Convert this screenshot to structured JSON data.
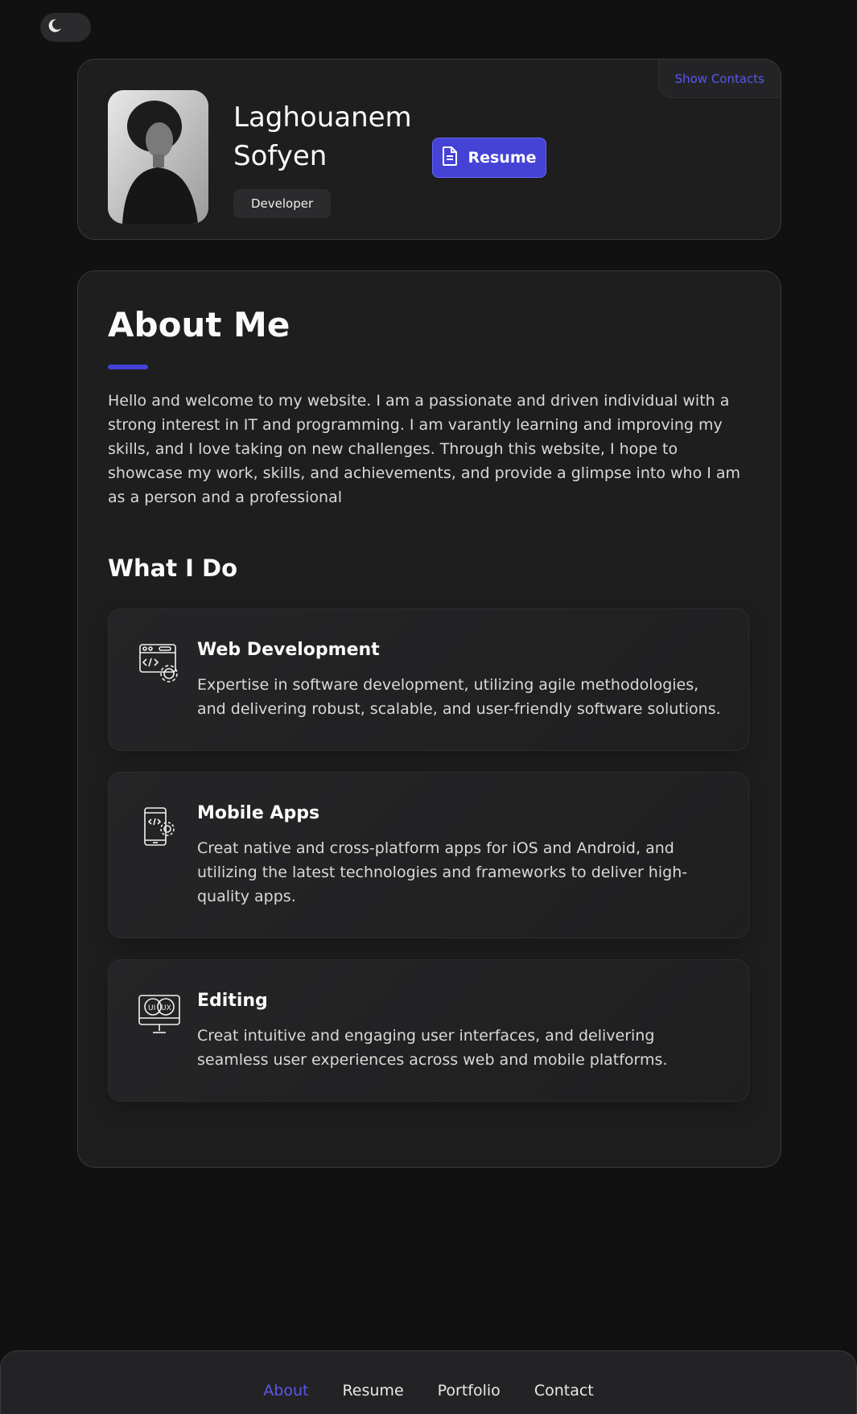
{
  "theme_toggle": {
    "icon": "moon-icon"
  },
  "profile": {
    "name_line1": "Laghouanem",
    "name_line2": "Sofyen",
    "role": "Developer",
    "resume_label": "Resume",
    "show_contacts_label": "Show Contacts"
  },
  "about": {
    "title": "About Me",
    "text": "Hello and welcome to my website. I am a passionate and driven individual with a strong interest in IT and programming. I am varantly learning and improving my skills, and I love taking on new challenges. Through this website, I hope to showcase my work, skills, and achievements, and provide a glimpse into who I am as a person and a professional",
    "what_i_do_title": "What I Do",
    "services": [
      {
        "icon": "web-development-icon",
        "title": "Web Development",
        "text": "Expertise in software development, utilizing agile methodologies, and delivering robust, scalable, and user-friendly software solutions."
      },
      {
        "icon": "mobile-app-icon",
        "title": "Mobile Apps",
        "text": "Creat native and cross-platform apps for iOS and Android, and utilizing the latest technologies and frameworks to deliver high-quality apps."
      },
      {
        "icon": "ui-ux-monitor-icon",
        "title": "Editing",
        "text": "Creat intuitive and engaging user interfaces, and delivering seamless user experiences across web and mobile platforms."
      }
    ]
  },
  "nav": {
    "items": [
      "About",
      "Resume",
      "Portfolio",
      "Contact"
    ],
    "active": "About"
  },
  "colors": {
    "background": "#111112",
    "card": "#1e1e1f",
    "accent": "#4543d6",
    "accent_text": "#5957f0"
  }
}
